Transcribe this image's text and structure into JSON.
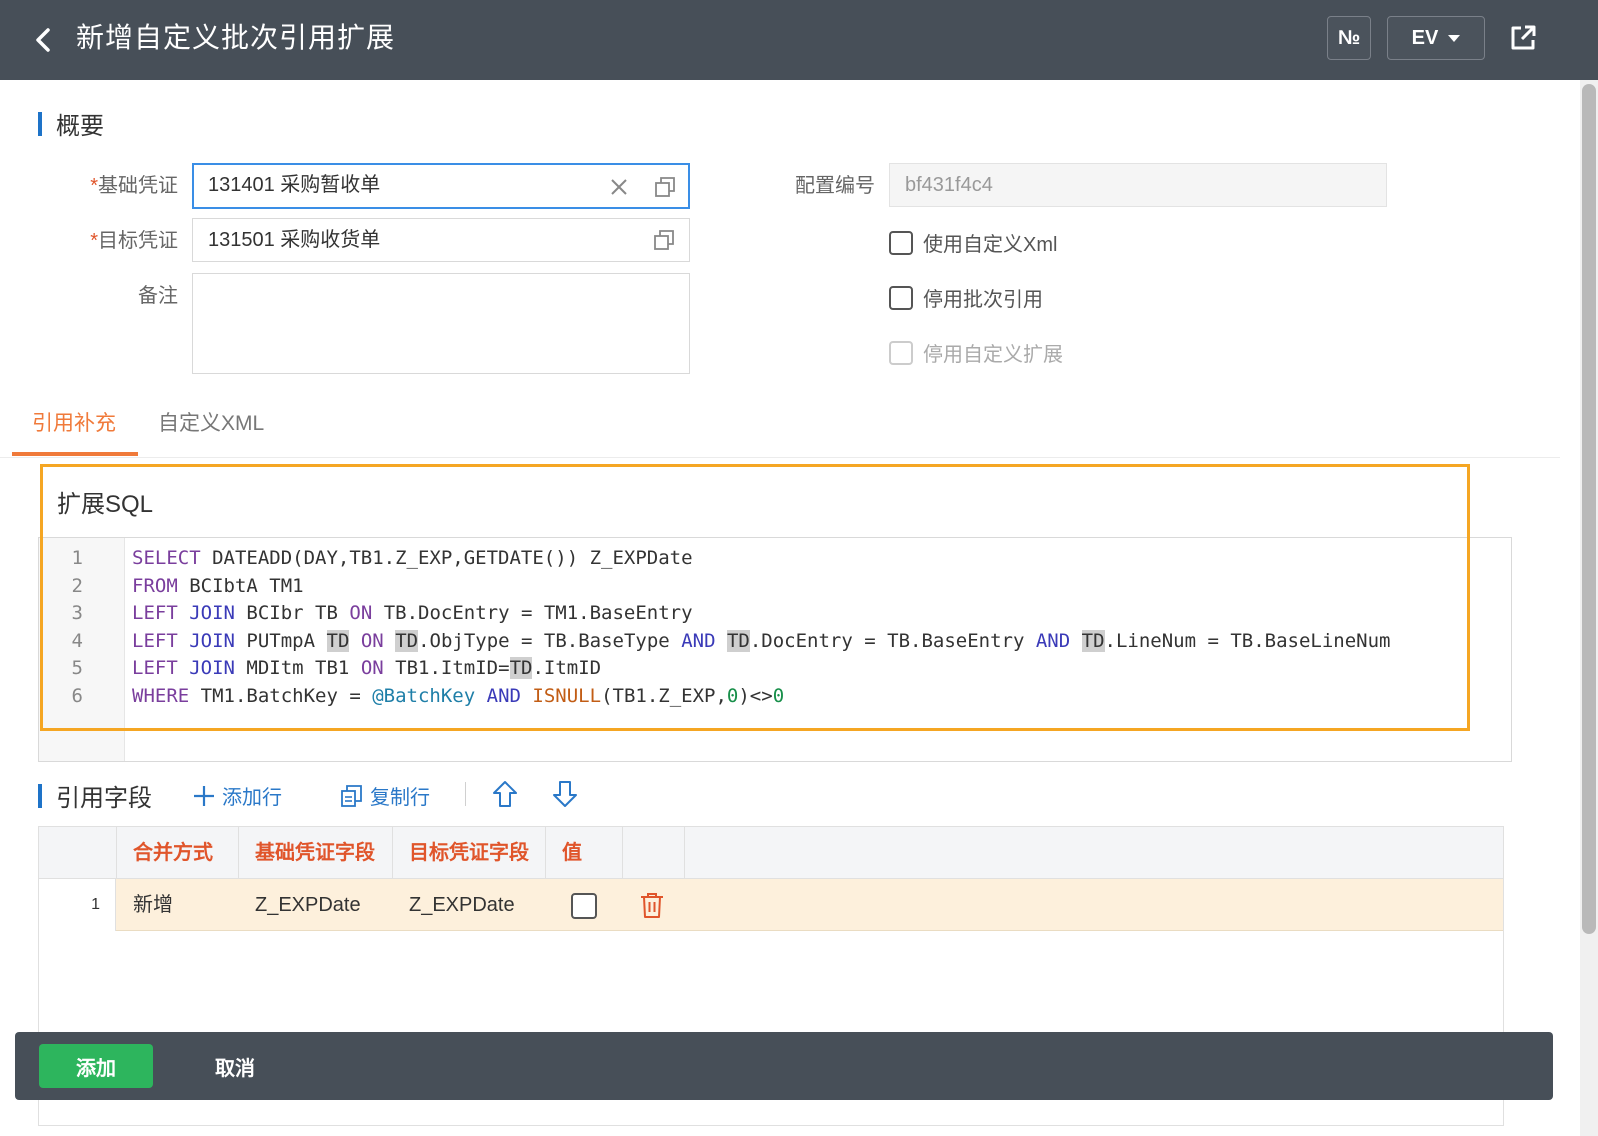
{
  "header": {
    "title": "新增自定义批次引用扩展",
    "no_label": "№",
    "ev_label": "EV"
  },
  "summary": {
    "heading": "概要",
    "base_voucher_label": "基础凭证",
    "base_voucher_value": "131401 采购暂收单",
    "target_voucher_label": "目标凭证",
    "target_voucher_value": "131501 采购收货单",
    "remark_label": "备注",
    "remark_value": "",
    "config_no_label": "配置编号",
    "config_no_value": "bf431f4c4",
    "use_custom_xml": "使用自定义Xml",
    "disable_batch_ref": "停用批次引用",
    "disable_custom_ext": "停用自定义扩展"
  },
  "tabs": [
    "引用补充",
    "自定义XML"
  ],
  "sql": {
    "heading": "扩展SQL",
    "line_numbers": [
      "1",
      "2",
      "3",
      "4",
      "5",
      "6"
    ]
  },
  "fields": {
    "heading": "引用字段",
    "add_row": "添加行",
    "copy_row": "复制行",
    "columns": [
      "合并方式",
      "基础凭证字段",
      "目标凭证字段",
      "值"
    ],
    "rows": [
      {
        "num": "1",
        "merge": "新增",
        "base_field": "Z_EXPDate",
        "target_field": "Z_EXPDate"
      }
    ]
  },
  "footer": {
    "add": "添加",
    "cancel": "取消"
  },
  "colors": {
    "header_bg": "#474f58",
    "accent_orange": "#f07a3a",
    "link_blue": "#2a78c8",
    "add_green": "#2db55d",
    "highlight_box": "#f5a623"
  }
}
